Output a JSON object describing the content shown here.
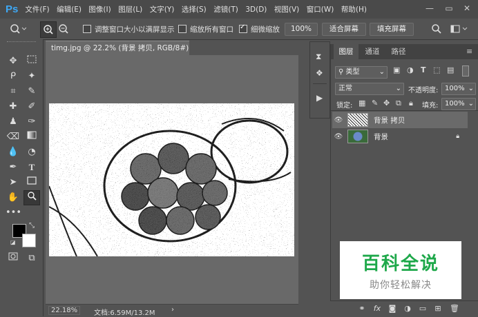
{
  "app": {
    "logo": "Ps"
  },
  "menu": [
    "文件(F)",
    "编辑(E)",
    "图像(I)",
    "图层(L)",
    "文字(Y)",
    "选择(S)",
    "滤镜(T)",
    "3D(D)",
    "视图(V)",
    "窗口(W)",
    "帮助(H)"
  ],
  "window_controls": {
    "minimize": "—",
    "restore": "▭",
    "close": "✕"
  },
  "options": {
    "resize_windows": "调整窗口大小以满屏显示",
    "zoom_all": "缩放所有窗口",
    "scrubby_zoom": "细微缩放",
    "zoom_value": "100%",
    "fit_screen": "适合屏幕",
    "fill_screen": "填充屏幕",
    "resize_windows_checked": false,
    "zoom_all_checked": false,
    "scrubby_zoom_checked": true
  },
  "document": {
    "tab_title": "timg.jpg @ 22.2% (背景 拷贝, RGB/8#) *",
    "tab_close": "×",
    "zoom": "22.18%",
    "doc_size": "文档:6.59M/13.2M",
    "status_arrow": "›"
  },
  "layers_panel": {
    "tabs": [
      "图层",
      "通道",
      "路径"
    ],
    "active_tab": 0,
    "filter_kind": "类型",
    "blend_mode": "正常",
    "opacity_label": "不透明度:",
    "opacity_value": "100%",
    "lock_label": "锁定:",
    "fill_label": "填充:",
    "fill_value": "100%",
    "layers": [
      {
        "name": "背景 拷贝",
        "selected": true,
        "locked": false
      },
      {
        "name": "背景",
        "selected": false,
        "locked": true
      }
    ]
  },
  "watermark": {
    "title": "百科全说",
    "subtitle": "助你轻松解决"
  },
  "colors": {
    "accent": "#3ea8f5",
    "watermark_green": "#1ea84a",
    "selection": "#6a6a6a"
  }
}
